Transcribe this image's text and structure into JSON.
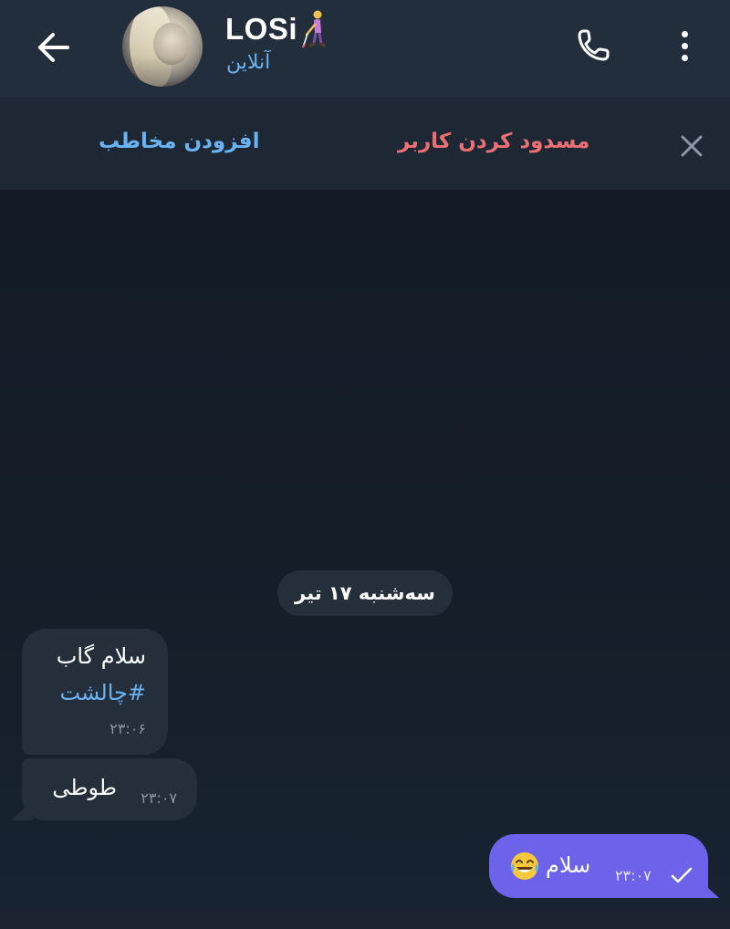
{
  "header": {
    "contact_name": "LOSi",
    "status": "آنلاین"
  },
  "action_bar": {
    "add_contact": "افزودن مخاطب",
    "block_user": "مسدود کردن کاربر"
  },
  "chat": {
    "date_label": "سه‌شنبه ۱۷ تیر",
    "messages": [
      {
        "direction": "in",
        "lines": [
          "سلام گاب",
          "#چالشت"
        ],
        "time": "۲۳:۰۶"
      },
      {
        "direction": "in",
        "text": "طوطی",
        "time": "۲۳:۰۷"
      },
      {
        "direction": "out",
        "text": "سلام",
        "time": "۲۳:۰۷"
      }
    ]
  },
  "colors": {
    "header_bg": "#232e3c",
    "chat_bg": "#141e29",
    "accent_blue": "#6ab3f3",
    "danger_red": "#ec6f73",
    "outgoing_bubble": "#6c63ea",
    "incoming_bubble": "#252f3b"
  },
  "icons": {
    "back": "arrow-left-icon",
    "call": "phone-icon",
    "menu": "more-vertical-icon",
    "close": "close-icon",
    "status_sent": "check-icon",
    "name_emoji": "person-with-cane-emoji",
    "message_emoji": "tears-of-joy-emoji"
  }
}
